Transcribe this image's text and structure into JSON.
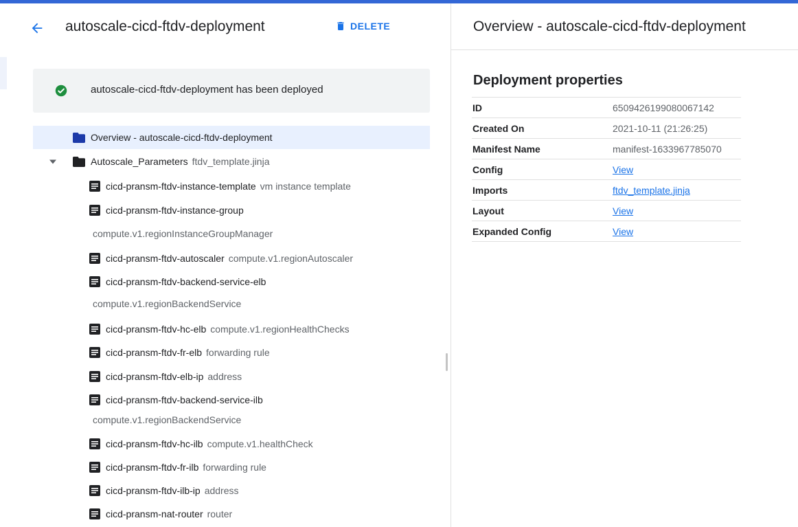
{
  "header": {
    "deployment_name": "autoscale-cicd-ftdv-deployment",
    "delete_label": "DELETE"
  },
  "banner": {
    "message": "autoscale-cicd-ftdv-deployment has been deployed",
    "icon": "check-circle-icon",
    "status_color": "#1e8e3e"
  },
  "tree": {
    "overview": {
      "label": "Overview - autoscale-cicd-ftdv-deployment"
    },
    "group": {
      "name": "Autoscale_Parameters",
      "type": "ftdv_template.jinja"
    },
    "resources": [
      {
        "name": "cicd-pransm-ftdv-instance-template",
        "type": "vm instance template"
      },
      {
        "name": "cicd-pransm-ftdv-instance-group",
        "type": "compute.v1.regionInstanceGroupManager"
      },
      {
        "name": "cicd-pransm-ftdv-autoscaler",
        "type": "compute.v1.regionAutoscaler"
      },
      {
        "name": "cicd-pransm-ftdv-backend-service-elb",
        "type": "compute.v1.regionBackendService"
      },
      {
        "name": "cicd-pransm-ftdv-hc-elb",
        "type": "compute.v1.regionHealthChecks"
      },
      {
        "name": "cicd-pransm-ftdv-fr-elb",
        "type": "forwarding rule"
      },
      {
        "name": "cicd-pransm-ftdv-elb-ip",
        "type": "address"
      },
      {
        "name": "cicd-pransm-ftdv-backend-service-ilb",
        "type": "compute.v1.regionBackendService"
      },
      {
        "name": "cicd-pransm-ftdv-hc-ilb",
        "type": "compute.v1.healthCheck"
      },
      {
        "name": "cicd-pransm-ftdv-fr-ilb",
        "type": "forwarding rule"
      },
      {
        "name": "cicd-pransm-ftdv-ilb-ip",
        "type": "address"
      },
      {
        "name": "cicd-pransm-nat-router",
        "type": "router"
      }
    ]
  },
  "overview": {
    "title": "Overview - autoscale-cicd-ftdv-deployment",
    "properties_title": "Deployment properties",
    "properties": [
      {
        "key": "ID",
        "value": "6509426199080067142",
        "link": false
      },
      {
        "key": "Created On",
        "value": "2021-10-11 (21:26:25)",
        "link": false
      },
      {
        "key": "Manifest Name",
        "value": "manifest-1633967785070",
        "link": false
      },
      {
        "key": "Config",
        "value": "View",
        "link": true
      },
      {
        "key": "Imports",
        "value": "ftdv_template.jinja",
        "link": true
      },
      {
        "key": "Layout",
        "value": "View",
        "link": true
      },
      {
        "key": "Expanded Config",
        "value": "View",
        "link": true
      }
    ]
  },
  "colors": {
    "accent": "#1a73e8",
    "folder": "#1c3aa9",
    "selected_bg": "#e8f0fe"
  }
}
